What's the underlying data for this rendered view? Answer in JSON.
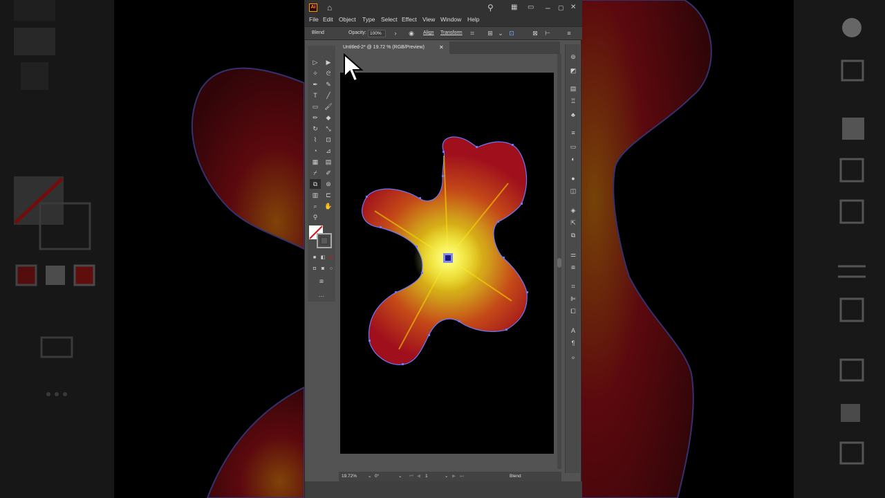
{
  "window": {
    "app_logo": "Ai",
    "icons": [
      "search-icon",
      "arrange-documents-icon",
      "workspace-icon",
      "minimize-icon",
      "maximize-icon",
      "close-icon"
    ]
  },
  "menu": {
    "items": [
      "File",
      "Edit",
      "Object",
      "Type",
      "Select",
      "Effect",
      "View",
      "Window",
      "Help"
    ]
  },
  "control_bar": {
    "object_type": "Blend",
    "opacity_label": "Opacity:",
    "opacity_value": "100%",
    "align_label": "Align",
    "transform_label": "Transform"
  },
  "document": {
    "tab_title": "Untitled-2* @ 19.72 % (RGB/Preview)",
    "tab_close": "✕"
  },
  "status_bar": {
    "zoom": "19.72%",
    "rotation": "0°",
    "artboard_number": "1",
    "current_tool": "Blend"
  },
  "colors": {
    "ui_dark": "#323232",
    "ui_mid": "#535353",
    "artboard": "#000000",
    "blend_outer": "#b01818",
    "blend_inner": "#f3e100",
    "anchor_blue": "#6a78ff"
  }
}
